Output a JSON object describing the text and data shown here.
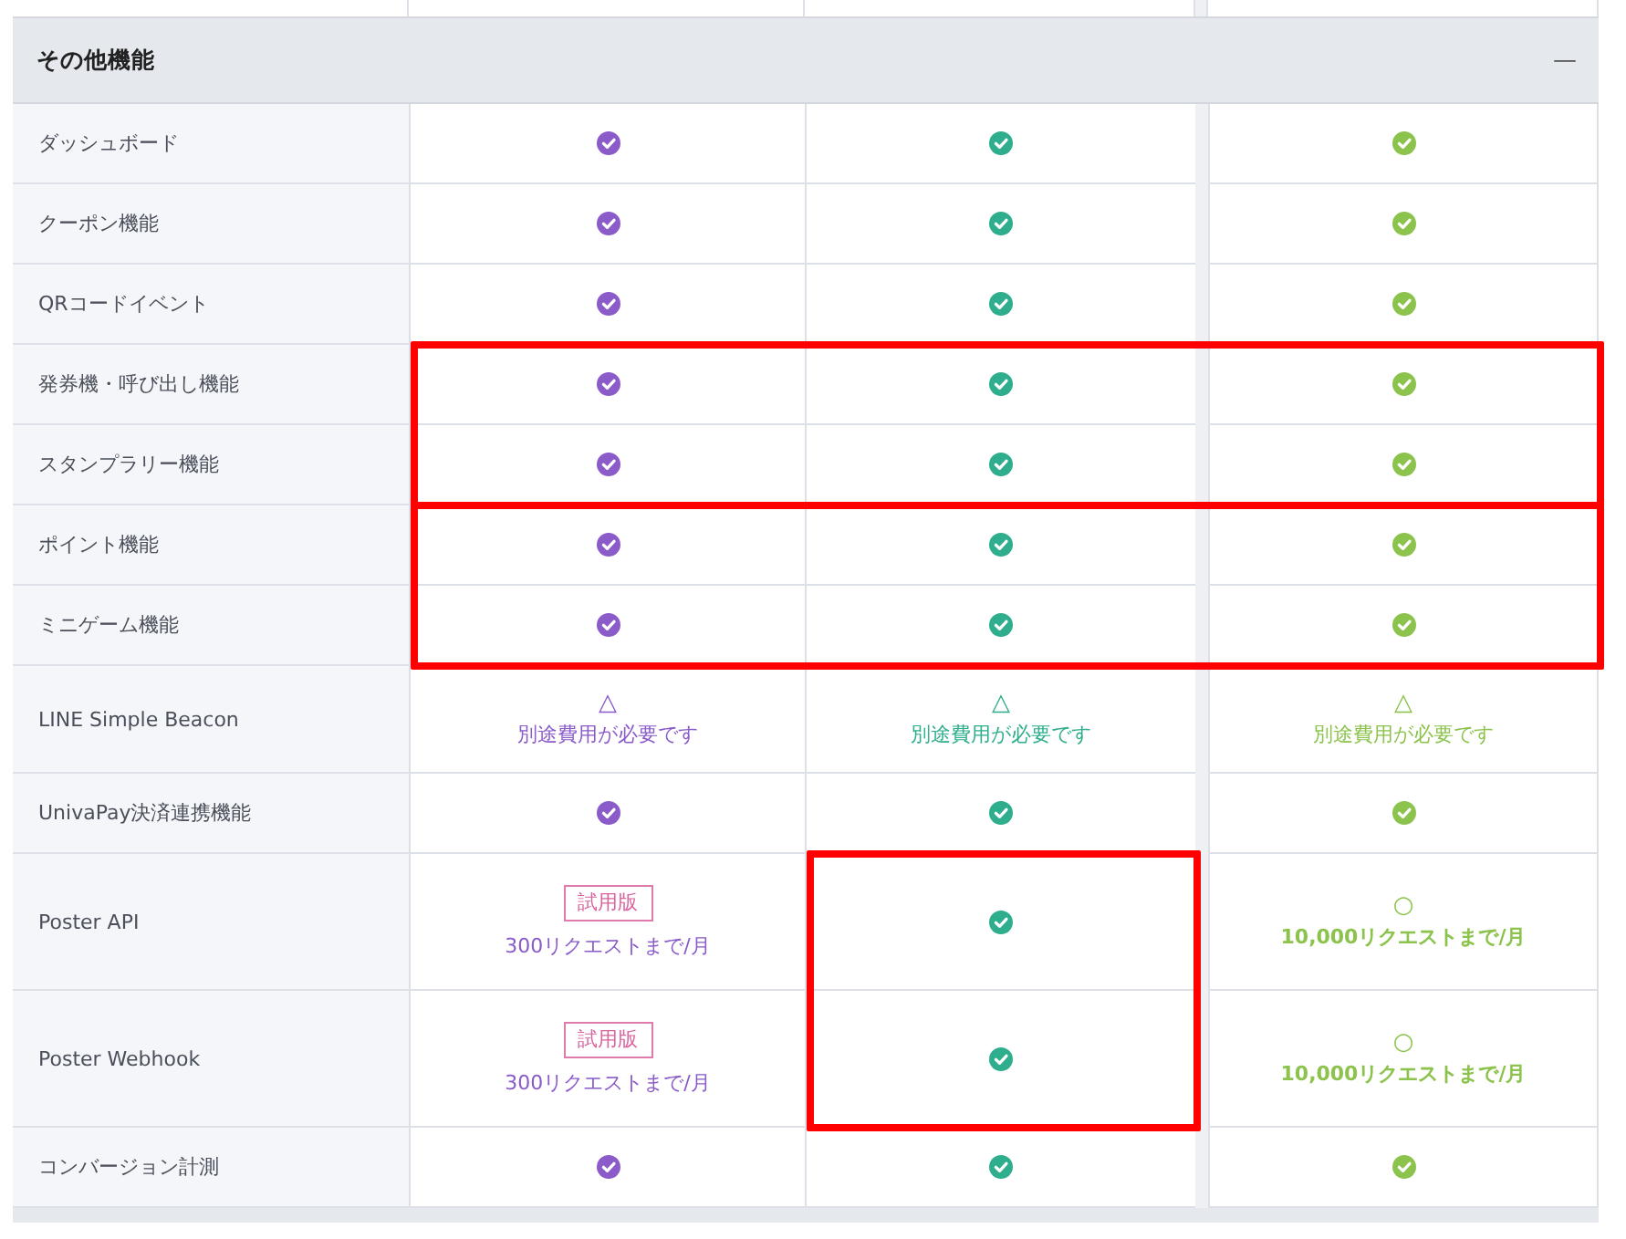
{
  "section": {
    "title": "その他機能",
    "collapse_symbol": "—",
    "expanded": true
  },
  "plans": [
    {
      "color": "#8a5bc9"
    },
    {
      "color": "#2eae8c"
    },
    {
      "color": "#8cc34d"
    }
  ],
  "groups": [
    {
      "kind": "plain",
      "outlined": false,
      "rows": [
        {
          "label": "ダッシュボード",
          "cells": [
            {
              "kind": "check"
            },
            {
              "kind": "check"
            },
            {
              "kind": "check"
            }
          ]
        },
        {
          "label": "クーポン機能",
          "cells": [
            {
              "kind": "check"
            },
            {
              "kind": "check"
            },
            {
              "kind": "check"
            }
          ]
        },
        {
          "label": "QRコードイベント",
          "cells": [
            {
              "kind": "check"
            },
            {
              "kind": "check"
            },
            {
              "kind": "check"
            }
          ]
        }
      ]
    },
    {
      "kind": "all-plans",
      "outlined": true,
      "rows": [
        {
          "label": "発券機・呼び出し機能",
          "cells": [
            {
              "kind": "check"
            },
            {
              "kind": "check"
            },
            {
              "kind": "check"
            }
          ]
        },
        {
          "label": "スタンプラリー機能",
          "cells": [
            {
              "kind": "check"
            },
            {
              "kind": "check"
            },
            {
              "kind": "check"
            }
          ]
        }
      ]
    },
    {
      "kind": "all-plans",
      "outlined": true,
      "rows": [
        {
          "label": "ポイント機能",
          "cells": [
            {
              "kind": "check"
            },
            {
              "kind": "check"
            },
            {
              "kind": "check"
            }
          ]
        },
        {
          "label": "ミニゲーム機能",
          "cells": [
            {
              "kind": "check"
            },
            {
              "kind": "check"
            },
            {
              "kind": "check"
            }
          ]
        }
      ]
    },
    {
      "kind": "plain",
      "outlined": false,
      "rows": [
        {
          "label": "LINE Simple Beacon",
          "cells": [
            {
              "kind": "mark",
              "mark": "△",
              "note": "別途費用が必要です"
            },
            {
              "kind": "mark",
              "mark": "△",
              "note": "別途費用が必要です"
            },
            {
              "kind": "mark",
              "mark": "△",
              "note": "別途費用が必要です"
            }
          ]
        },
        {
          "label": "UnivaPay決済連携機能",
          "cells": [
            {
              "kind": "check"
            },
            {
              "kind": "check"
            },
            {
              "kind": "check"
            }
          ]
        }
      ]
    },
    {
      "kind": "middle-plan",
      "outlined": true,
      "rows": [
        {
          "label": "Poster API",
          "cells": [
            {
              "kind": "trial",
              "badge": "試用版",
              "note": "300リクエストまで/月"
            },
            {
              "kind": "check"
            },
            {
              "kind": "limit",
              "mark": "○",
              "note": "10,000リクエストまで/月"
            }
          ]
        },
        {
          "label": "Poster Webhook",
          "cells": [
            {
              "kind": "trial",
              "badge": "試用版",
              "note": "300リクエストまで/月"
            },
            {
              "kind": "check"
            },
            {
              "kind": "limit",
              "mark": "○",
              "note": "10,000リクエストまで/月"
            }
          ]
        }
      ]
    },
    {
      "kind": "plain",
      "outlined": false,
      "rows": [
        {
          "label": "コンバージョン計測",
          "cells": [
            {
              "kind": "check"
            },
            {
              "kind": "check"
            },
            {
              "kind": "check"
            }
          ]
        }
      ]
    }
  ]
}
